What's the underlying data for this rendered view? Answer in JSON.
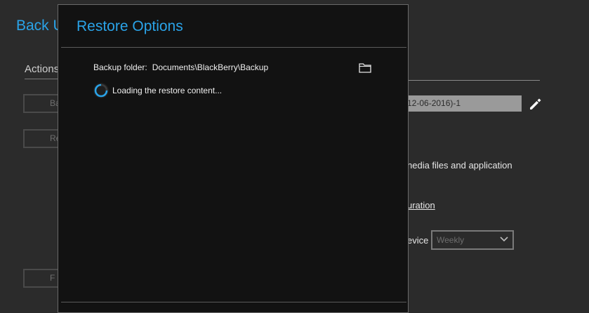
{
  "background": {
    "title": "Back U",
    "actions_label": "Actions",
    "buttons": [
      {
        "label": "Ba"
      },
      {
        "label": "Re"
      },
      {
        "label": "F"
      }
    ],
    "backup_name_value": "12-06-2016)-1",
    "media_text": "nedia files and application",
    "configuration_link": "uration",
    "device_label": "evice",
    "schedule_select_value": "Weekly"
  },
  "dialog": {
    "title": "Restore Options",
    "backup_folder_label": "Backup folder:",
    "backup_folder_path": "Documents\\BlackBerry\\Backup",
    "loading_text": "Loading the restore content..."
  },
  "icons": {
    "folder": "folder-icon",
    "edit": "pencil-icon",
    "spinner": "loading-spinner-icon",
    "chevron": "chevron-down-icon"
  },
  "colors": {
    "accent": "#2aa3e8",
    "background": "#2b2b2b",
    "dialog_background": "#121212"
  }
}
